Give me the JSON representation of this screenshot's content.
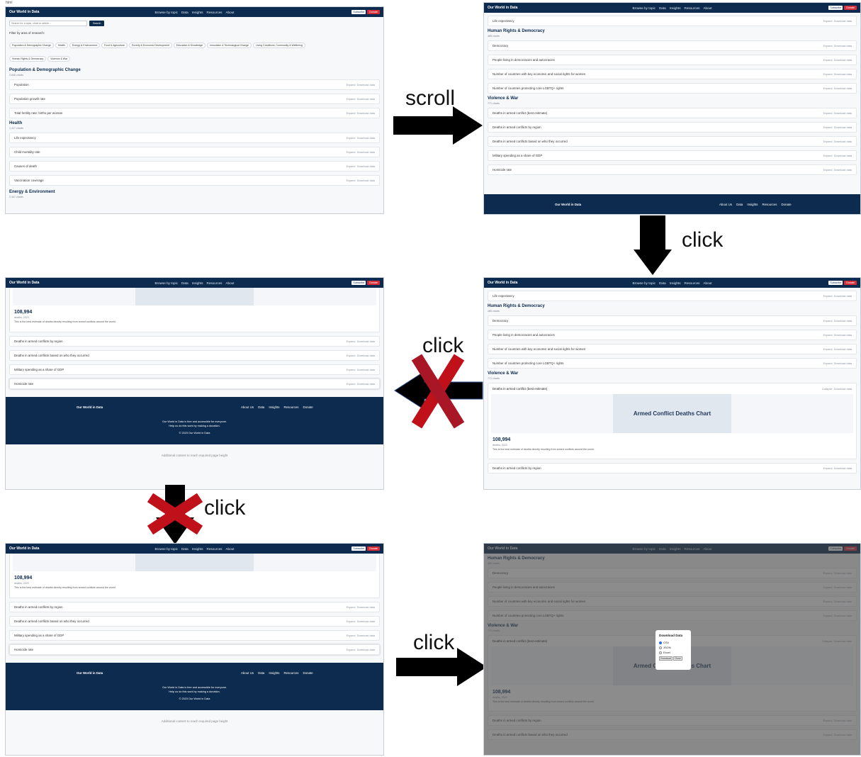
{
  "top_label": "html",
  "brand": "Our World in Data",
  "nav": [
    "Browse by topic",
    "Data",
    "Insights",
    "Resources",
    "About"
  ],
  "subscribe": "Subscribe",
  "donate": "Donate",
  "search": {
    "placeholder": "Search for a topic, chart or article...",
    "button": "Search"
  },
  "filter_label": "Filter by area of research:",
  "filters": [
    "Population & Demographic Change",
    "Health",
    "Energy & Environment",
    "Food & Agriculture",
    "Poverty & Economic Development",
    "Education & Knowledge",
    "Innovation & Technological Change",
    "Living Conditions, Community & Wellbeing",
    "Human Rights & Democracy",
    "Violence & War"
  ],
  "expand": "Expand",
  "collapse": "Collapse",
  "download": "Download data",
  "sections": {
    "population": {
      "title": "Population & Demographic Change",
      "count": "2,846 charts",
      "items": [
        "Population",
        "Population growth rate",
        "Total fertility rate: births per woman"
      ]
    },
    "health": {
      "title": "Health",
      "count": "1,417 charts",
      "items": [
        "Life expectancy",
        "Child mortality rate",
        "Causes of death",
        "Vaccination coverage"
      ]
    },
    "energy": {
      "title": "Energy & Environment",
      "count": "2,347 charts"
    },
    "rights": {
      "title": "Human Rights & Democracy",
      "count": "485 charts",
      "items": [
        "Democracy",
        "People living in democracies and autocracies",
        "Number of countries with key economic and social rights for women",
        "Number of countries protecting core LGBTQ+ rights"
      ]
    },
    "war": {
      "title": "Violence & War",
      "count": "771 charts",
      "items": [
        "Deaths in armed conflict (best estimate)",
        "Deaths in armed conflicts by region",
        "Deaths in armed conflicts based on who they occurred",
        "Military spending as a share of GDP",
        "Homicide rate"
      ]
    }
  },
  "chart": {
    "title": "Armed Conflict Deaths Chart",
    "value": "108,994",
    "unit": "deaths, 2023",
    "desc": "This is the best estimate of deaths directly resulting from armed conflicts around the world."
  },
  "footer": {
    "links": [
      "About Us",
      "Data",
      "Insights",
      "Resources",
      "Donate"
    ],
    "line1": "Our World in Data is free and accessible for everyone.",
    "line2": "Help us do this work by making a donation.",
    "copy": "© 2023 Our World in Data",
    "extra": "Additional content to reach required page height"
  },
  "modal": {
    "title": "Download Data",
    "options": [
      "CSV",
      "JSON",
      "Excel"
    ],
    "download": "Download",
    "close": "Close"
  },
  "actions": [
    "scroll",
    "click",
    "click",
    "click",
    "click"
  ]
}
